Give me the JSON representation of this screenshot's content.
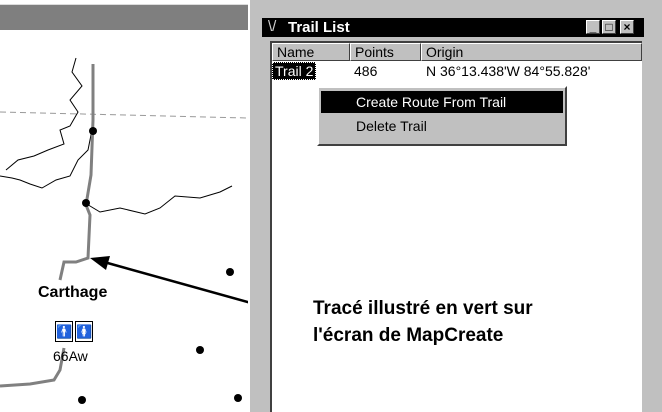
{
  "map": {
    "city_label": "Carthage",
    "highway_label": "66Aw",
    "restroom_icons": [
      "man-icon",
      "woman-icon"
    ]
  },
  "trail_list": {
    "title": "Trail List",
    "window_controls": [
      "_",
      "□",
      "×"
    ],
    "columns": [
      "Name",
      "Points",
      "Origin"
    ],
    "rows": [
      {
        "name": "Trail 2",
        "points": "486",
        "origin": "N 36°13.438'W 84°55.828'"
      }
    ]
  },
  "context_menu": {
    "items": [
      {
        "label": "Create Route From Trail",
        "active": true
      },
      {
        "label": "Delete Trail",
        "active": false
      }
    ]
  },
  "caption": {
    "line1": "Tracé illustré en vert sur",
    "line2": "l'écran de MapCreate"
  },
  "colors": {
    "title_bar": "#000000",
    "window_face": "#c0c0c0",
    "trail_line": "#808080"
  }
}
